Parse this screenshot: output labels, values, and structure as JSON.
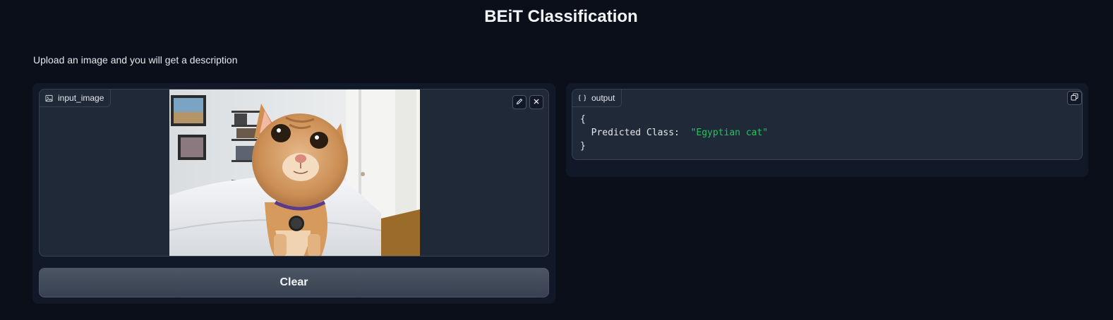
{
  "header": {
    "title": "BEiT Classification",
    "description": "Upload an image and you will get a description"
  },
  "input": {
    "label": "input_image",
    "label_icon": "image-icon",
    "edit_icon": "pencil-icon",
    "close_icon": "close-icon",
    "clear_label": "Clear"
  },
  "output": {
    "label": "output",
    "label_icon": "braces-icon",
    "copy_icon": "copy-icon",
    "open_brace": "{",
    "key": "Predicted Class:",
    "value": "\"Egyptian cat\"",
    "close_brace": "}"
  },
  "colors": {
    "background": "#0b0f19",
    "panel": "#111827",
    "block": "#1f2937",
    "string_value": "#22c55e"
  }
}
